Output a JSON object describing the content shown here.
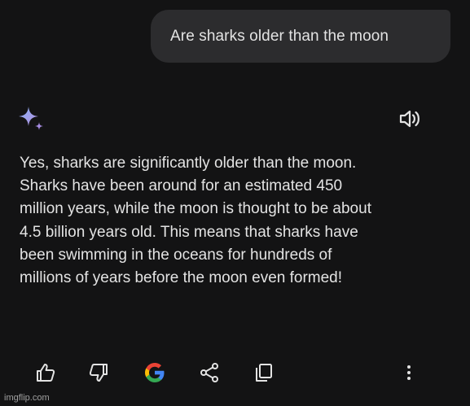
{
  "user_message": "Are sharks older than the moon",
  "response": {
    "lines": [
      "Yes, sharks are significantly older than the moon.",
      "Sharks have been around for an estimated 450",
      "million years, while the moon is thought to be about",
      "4.5 billion years old. This means that sharks have",
      "been swimming in the oceans for hundreds of",
      "millions of years before the moon even formed!"
    ]
  },
  "icons": {
    "assistant": "sparkle-icon",
    "read_aloud": "speaker-icon",
    "actions": [
      "thumbs-up-icon",
      "thumbs-down-icon",
      "google-icon",
      "share-icon",
      "copy-icon",
      "more-vert-icon"
    ]
  },
  "colors": {
    "background": "#131314",
    "bubble": "#2c2c2e",
    "text": "#e3e3e3",
    "sparkle": "#9b8ce6",
    "google_blue": "#4285F4",
    "google_red": "#EA4335",
    "google_yellow": "#FBBC05",
    "google_green": "#34A853"
  },
  "watermark": "imgflip.com"
}
